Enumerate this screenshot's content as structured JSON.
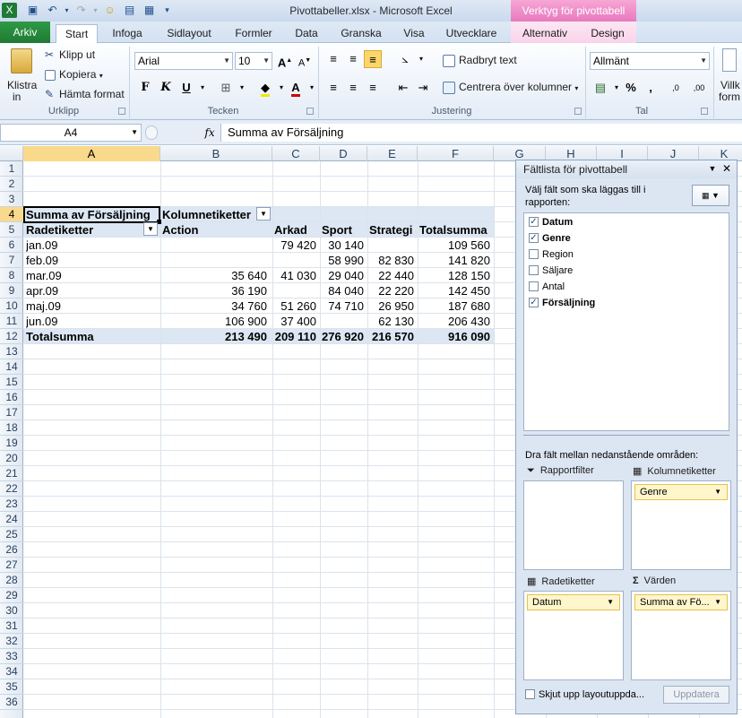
{
  "window": {
    "title": "Pivottabeller.xlsx - Microsoft Excel",
    "context_title": "Verktyg för pivottabell"
  },
  "tabs": {
    "file": "Arkiv",
    "items": [
      "Start",
      "Infoga",
      "Sidlayout",
      "Formler",
      "Data",
      "Granska",
      "Visa",
      "Utvecklare"
    ],
    "context": [
      "Alternativ",
      "Design"
    ]
  },
  "ribbon": {
    "clipboard": {
      "paste": "Klistra",
      "paste2": "in",
      "cut": "Klipp ut",
      "copy": "Kopiera",
      "format_painter": "Hämta format",
      "label": "Urklipp"
    },
    "font": {
      "name": "Arial",
      "size": "10",
      "bold": "F",
      "italic": "K",
      "underline": "U",
      "label": "Tecken"
    },
    "alignment": {
      "wrap": "Radbryt text",
      "merge": "Centrera över kolumner",
      "label": "Justering"
    },
    "number": {
      "format": "Allmänt",
      "percent": "%",
      "comma": ",",
      "inc": ",0",
      "dec": ",00",
      "label": "Tal"
    },
    "conditional": {
      "l1": "Villk",
      "l2": "form"
    }
  },
  "formula_bar": {
    "name_box": "A4",
    "fx": "fx",
    "content": "Summa av Försäljning"
  },
  "columns": [
    "A",
    "B",
    "C",
    "D",
    "E",
    "F",
    "G",
    "H",
    "I",
    "J",
    "K"
  ],
  "rows": [
    "1",
    "2",
    "3",
    "4",
    "5",
    "6",
    "7",
    "8",
    "9",
    "10",
    "11",
    "12",
    "13",
    "14",
    "15",
    "16",
    "17",
    "18",
    "19",
    "20",
    "21",
    "22",
    "23",
    "24",
    "25",
    "26",
    "27",
    "28",
    "29",
    "30",
    "31",
    "32",
    "33",
    "34",
    "35",
    "36"
  ],
  "pivot": {
    "values_label": "Summa av Försäljning",
    "col_labels": "Kolumnetiketter",
    "row_labels": "Radetiketter",
    "headers": [
      "Action",
      "Arkad",
      "Sport",
      "Strategi",
      "Totalsumma"
    ],
    "rows": [
      {
        "label": "jan.09",
        "values": [
          "",
          "79 420",
          "30 140",
          "",
          "109 560"
        ]
      },
      {
        "label": "feb.09",
        "values": [
          "",
          "",
          "58 990",
          "82 830",
          "141 820"
        ]
      },
      {
        "label": "mar.09",
        "values": [
          "35 640",
          "41 030",
          "29 040",
          "22 440",
          "128 150"
        ]
      },
      {
        "label": "apr.09",
        "values": [
          "36 190",
          "",
          "84 040",
          "22 220",
          "142 450"
        ]
      },
      {
        "label": "maj.09",
        "values": [
          "34 760",
          "51 260",
          "74 710",
          "26 950",
          "187 680"
        ]
      },
      {
        "label": "jun.09",
        "values": [
          "106 900",
          "37 400",
          "",
          "62 130",
          "206 430"
        ]
      }
    ],
    "total": {
      "label": "Totalsumma",
      "values": [
        "213 490",
        "209 110",
        "276 920",
        "216 570",
        "916 090"
      ]
    }
  },
  "field_list": {
    "title": "Fältlista för pivottabell",
    "prompt": "Välj fält som ska läggas till i rapporten:",
    "fields": [
      {
        "name": "Datum",
        "checked": true
      },
      {
        "name": "Genre",
        "checked": true
      },
      {
        "name": "Region",
        "checked": false
      },
      {
        "name": "Säljare",
        "checked": false
      },
      {
        "name": "Antal",
        "checked": false
      },
      {
        "name": "Försäljning",
        "checked": true
      }
    ],
    "drag_prompt": "Dra fält mellan nedanstående områden:",
    "report_filter": "Rapportfilter",
    "column_labels": "Kolumnetiketter",
    "row_labels": "Radetiketter",
    "values": "Värden",
    "column_chip": "Genre",
    "row_chip": "Datum",
    "values_chip": "Summa av Fö...",
    "defer": "Skjut upp layoutuppda...",
    "update": "Uppdatera"
  }
}
